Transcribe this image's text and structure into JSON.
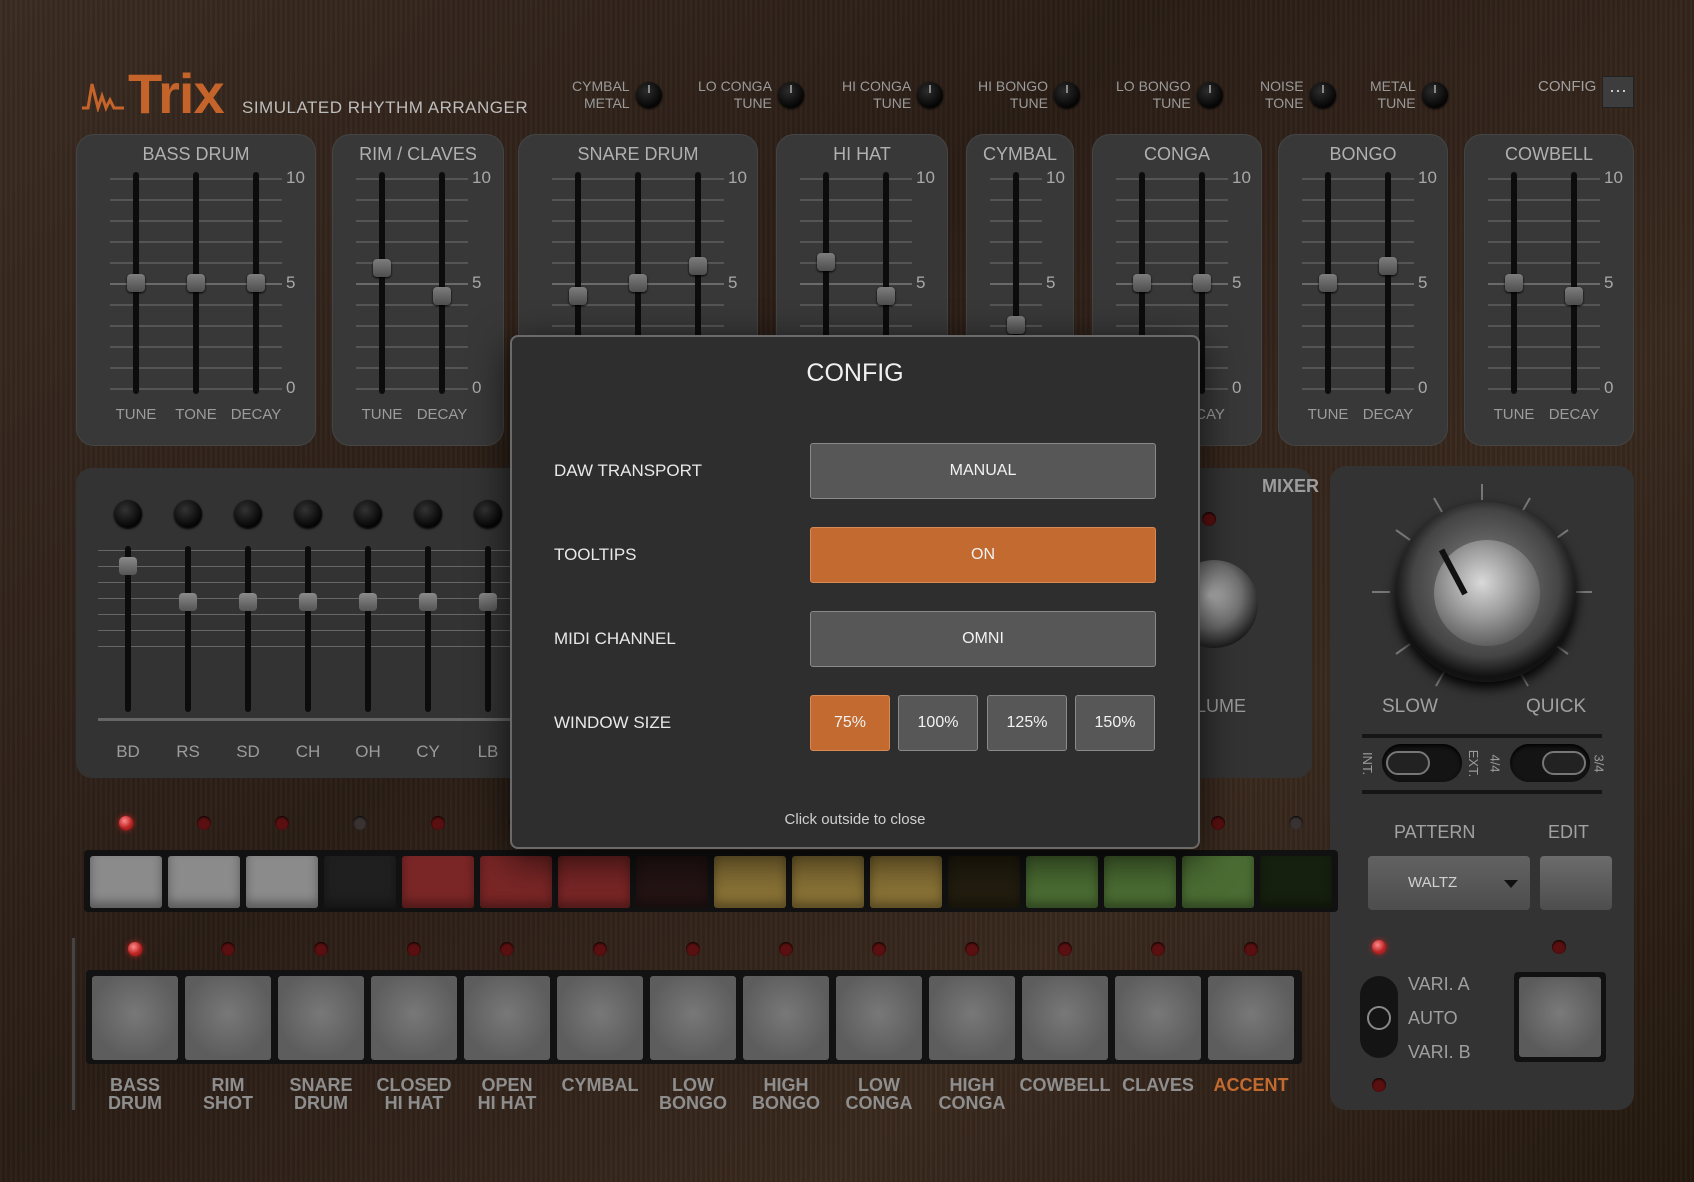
{
  "header": {
    "logo": "Trix",
    "subtitle": "SIMULATED RHYTHM ARRANGER",
    "knobs": [
      {
        "line1": "CYMBAL",
        "line2": "METAL"
      },
      {
        "line1": "LO CONGA",
        "line2": "TUNE"
      },
      {
        "line1": "HI CONGA",
        "line2": "TUNE"
      },
      {
        "line1": "HI BONGO",
        "line2": "TUNE"
      },
      {
        "line1": "LO BONGO",
        "line2": "TUNE"
      },
      {
        "line1": "NOISE",
        "line2": "TONE"
      },
      {
        "line1": "METAL",
        "line2": "TUNE"
      }
    ],
    "config_label": "CONFIG",
    "config_button": "···"
  },
  "cards": [
    {
      "title": "BASS DRUM",
      "labels": [
        "TUNE",
        "TONE",
        "DECAY"
      ]
    },
    {
      "title": "RIM / CLAVES",
      "labels": [
        "TUNE",
        "DECAY"
      ]
    },
    {
      "title": "SNARE DRUM",
      "labels": []
    },
    {
      "title": "HI HAT",
      "labels": []
    },
    {
      "title": "CYMBAL",
      "labels": []
    },
    {
      "title": "CONGA",
      "labels": [
        "CAY"
      ]
    },
    {
      "title": "BONGO",
      "labels": [
        "TUNE",
        "DECAY"
      ]
    },
    {
      "title": "COWBELL",
      "labels": [
        "TUNE",
        "DECAY"
      ]
    }
  ],
  "scale": {
    "max": "10",
    "mid": "5",
    "min": "0"
  },
  "mixer": {
    "title": "MIXER",
    "channels": [
      "BD",
      "RS",
      "SD",
      "CH",
      "OH",
      "CY",
      "LB"
    ],
    "volume_label": "LUME"
  },
  "tempo": {
    "slow": "SLOW",
    "quick": "QUICK",
    "int": "INT.",
    "ext": "EXT.",
    "m44": "4/4",
    "m34": "3/4",
    "pattern_label": "PATTERN",
    "edit_label": "EDIT",
    "pattern_value": "WALTZ",
    "vari_a": "VARI. A",
    "auto": "AUTO",
    "vari_b": "VARI. B"
  },
  "pads": [
    {
      "l1": "BASS",
      "l2": "DRUM"
    },
    {
      "l1": "RIM",
      "l2": "SHOT"
    },
    {
      "l1": "SNARE",
      "l2": "DRUM"
    },
    {
      "l1": "CLOSED",
      "l2": "HI HAT"
    },
    {
      "l1": "OPEN",
      "l2": "HI HAT"
    },
    {
      "l1": "CYMBAL",
      "l2": ""
    },
    {
      "l1": "LOW",
      "l2": "BONGO"
    },
    {
      "l1": "HIGH",
      "l2": "BONGO"
    },
    {
      "l1": "LOW",
      "l2": "CONGA"
    },
    {
      "l1": "HIGH",
      "l2": "CONGA"
    },
    {
      "l1": "COWBELL",
      "l2": ""
    },
    {
      "l1": "CLAVES",
      "l2": ""
    },
    {
      "l1": "ACCENT",
      "l2": ""
    }
  ],
  "modal": {
    "title": "CONFIG",
    "rows": [
      {
        "label": "DAW TRANSPORT",
        "value": "MANUAL"
      },
      {
        "label": "TOOLTIPS",
        "value": "ON"
      },
      {
        "label": "MIDI CHANNEL",
        "value": "OMNI"
      },
      {
        "label": "WINDOW SIZE",
        "options": [
          "75%",
          "100%",
          "125%",
          "150%"
        ],
        "selected": "75%"
      }
    ],
    "hint": "Click outside to close"
  },
  "colors": {
    "accent": "#c26a30",
    "led_on": "#b81f1f",
    "panel": "#2b2b2b"
  }
}
